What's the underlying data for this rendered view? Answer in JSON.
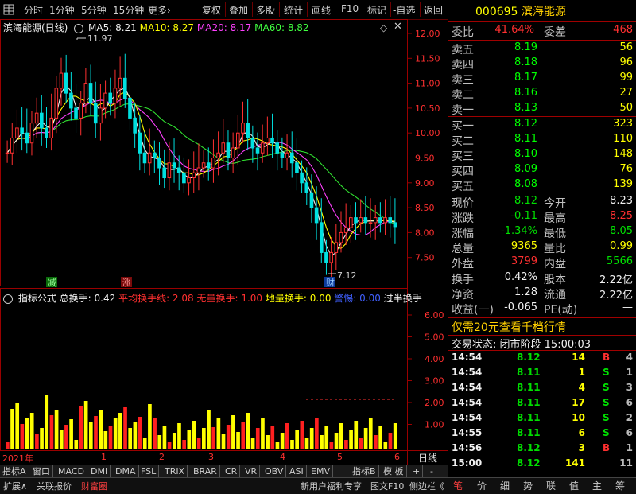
{
  "toolbar": {
    "left_icon": "grid-icon",
    "items": [
      "分时",
      "1分钟",
      "5分钟",
      "15分钟",
      "更多›",
      "复权",
      "叠加",
      "多股",
      "统计",
      "画线",
      "F10",
      "标记",
      "-自选",
      "返回"
    ]
  },
  "kline": {
    "title": "滨海能源(日线)",
    "ma5": "MA5: 8.21",
    "ma10": "MA10: 8.27",
    "ma20": "MA20: 8.17",
    "ma60": "MA60: 8.82",
    "high_label": "11.97",
    "low_label": "7.12",
    "price_ticks": [
      "12.00",
      "11.50",
      "11.00",
      "10.50",
      "10.00",
      "9.50",
      "9.00",
      "8.50",
      "8.00",
      "7.50"
    ],
    "markers": {
      "reduce": "减",
      "rise": "涨",
      "fin": "财"
    }
  },
  "indicator": {
    "name": "指标公式",
    "total": "总换手: 0.42",
    "avg": "平均换手线: 2.08",
    "none": "无量换手: 1.00",
    "ground": "地量换手: 0.00",
    "warn": "警惕: 0.00",
    "half": "过半换手",
    "ticks": [
      "6.00",
      "5.00",
      "4.00",
      "3.00",
      "2.00",
      "1.00"
    ]
  },
  "time_axis": {
    "year": "2021年",
    "months": [
      "1",
      "2",
      "3",
      "4",
      "5",
      "6"
    ],
    "period": "日线"
  },
  "indicator_tabs": [
    "指标A",
    "窗口",
    "MACD",
    "DMI",
    "DMA",
    "FSL",
    "TRIX",
    "BRAR",
    "CR",
    "VR",
    "OBV",
    "ASI",
    "EMV"
  ],
  "indicator_tabs_right": [
    "指标B",
    "模 板",
    "+",
    "-"
  ],
  "status_bar": {
    "left": [
      "扩展∧",
      "关联报价",
      "财富圈"
    ],
    "right": [
      "新用户福利专享",
      "图文F10",
      "侧边栏《"
    ]
  },
  "quote": {
    "code": "000695",
    "name": "滨海能源",
    "weibi_label": "委比",
    "weibi": "41.64%",
    "weicha_label": "委差",
    "weicha": "468",
    "sells": [
      {
        "label": "卖五",
        "price": "8.19",
        "vol": "56"
      },
      {
        "label": "卖四",
        "price": "8.18",
        "vol": "96"
      },
      {
        "label": "卖三",
        "price": "8.17",
        "vol": "99"
      },
      {
        "label": "卖二",
        "price": "8.16",
        "vol": "27"
      },
      {
        "label": "卖一",
        "price": "8.13",
        "vol": "50"
      }
    ],
    "buys": [
      {
        "label": "买一",
        "price": "8.12",
        "vol": "323"
      },
      {
        "label": "买二",
        "price": "8.11",
        "vol": "110"
      },
      {
        "label": "买三",
        "price": "8.10",
        "vol": "148"
      },
      {
        "label": "买四",
        "price": "8.09",
        "vol": "76"
      },
      {
        "label": "买五",
        "price": "8.08",
        "vol": "139"
      }
    ],
    "stats": [
      {
        "l1": "现价",
        "v1": "8.12",
        "c1": "green",
        "l2": "今开",
        "v2": "8.23",
        "c2": "white"
      },
      {
        "l1": "涨跌",
        "v1": "-0.11",
        "c1": "green",
        "l2": "最高",
        "v2": "8.25",
        "c2": "red"
      },
      {
        "l1": "涨幅",
        "v1": "-1.34%",
        "c1": "green",
        "l2": "最低",
        "v2": "8.05",
        "c2": "green"
      },
      {
        "l1": "总量",
        "v1": "9365",
        "c1": "yellow",
        "l2": "量比",
        "v2": "0.99",
        "c2": "yellow"
      },
      {
        "l1": "外盘",
        "v1": "3799",
        "c1": "red",
        "l2": "内盘",
        "v2": "5566",
        "c2": "green"
      }
    ],
    "info": [
      {
        "l1": "换手",
        "v1": "0.42%",
        "l2": "股本",
        "v2": "2.22亿"
      },
      {
        "l1": "净资",
        "v1": "1.28",
        "l2": "流通",
        "v2": "2.22亿"
      },
      {
        "l1": "收益(一)",
        "v1": "-0.065",
        "l2": "PE(动)",
        "v2": "—"
      }
    ],
    "promo": "仅需20元查看千档行情",
    "trade_state": "交易状态: 闭市阶段",
    "trade_time": "15:00:03",
    "ticks": [
      {
        "t": "14:54",
        "p": "8.12",
        "v": "14",
        "d": "B",
        "n": "4"
      },
      {
        "t": "14:54",
        "p": "8.11",
        "v": "1",
        "d": "S",
        "n": "1"
      },
      {
        "t": "14:54",
        "p": "8.11",
        "v": "4",
        "d": "S",
        "n": "3"
      },
      {
        "t": "14:54",
        "p": "8.11",
        "v": "17",
        "d": "S",
        "n": "6"
      },
      {
        "t": "14:54",
        "p": "8.11",
        "v": "10",
        "d": "S",
        "n": "2"
      },
      {
        "t": "14:55",
        "p": "8.11",
        "v": "6",
        "d": "S",
        "n": "6"
      },
      {
        "t": "14:56",
        "p": "8.12",
        "v": "3",
        "d": "B",
        "n": "1"
      },
      {
        "t": "15:00",
        "p": "8.12",
        "v": "141",
        "d": "",
        "n": "11"
      }
    ],
    "tabs": [
      "笔",
      "价",
      "细",
      "势",
      "联",
      "值",
      "主",
      "筹"
    ]
  }
}
